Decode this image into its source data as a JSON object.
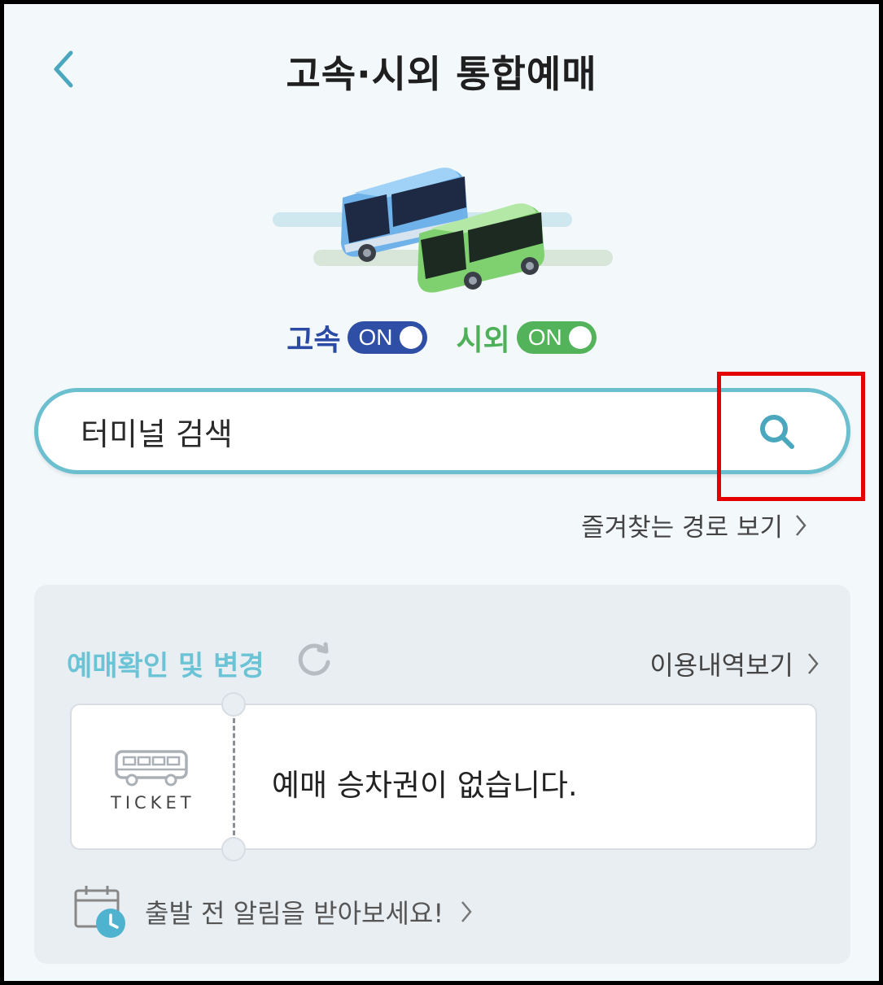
{
  "header": {
    "title": "고속·시외 통합예매"
  },
  "toggles": {
    "express": {
      "label": "고속",
      "state": "ON"
    },
    "intercity": {
      "label": "시외",
      "state": "ON"
    }
  },
  "search": {
    "placeholder": "터미널 검색"
  },
  "favorites": {
    "link_label": "즐겨찾는 경로 보기"
  },
  "reservations": {
    "title": "예매확인 및 변경",
    "history_label": "이용내역보기",
    "ticket_word": "TICKET",
    "empty_message": "예매 승차권이 없습니다."
  },
  "alert": {
    "label": "출발 전 알림을 받아보세요!"
  },
  "colors": {
    "accent": "#6bbfce",
    "express": "#2f4ea6",
    "intercity": "#52b35a",
    "highlight": "#e40000"
  }
}
